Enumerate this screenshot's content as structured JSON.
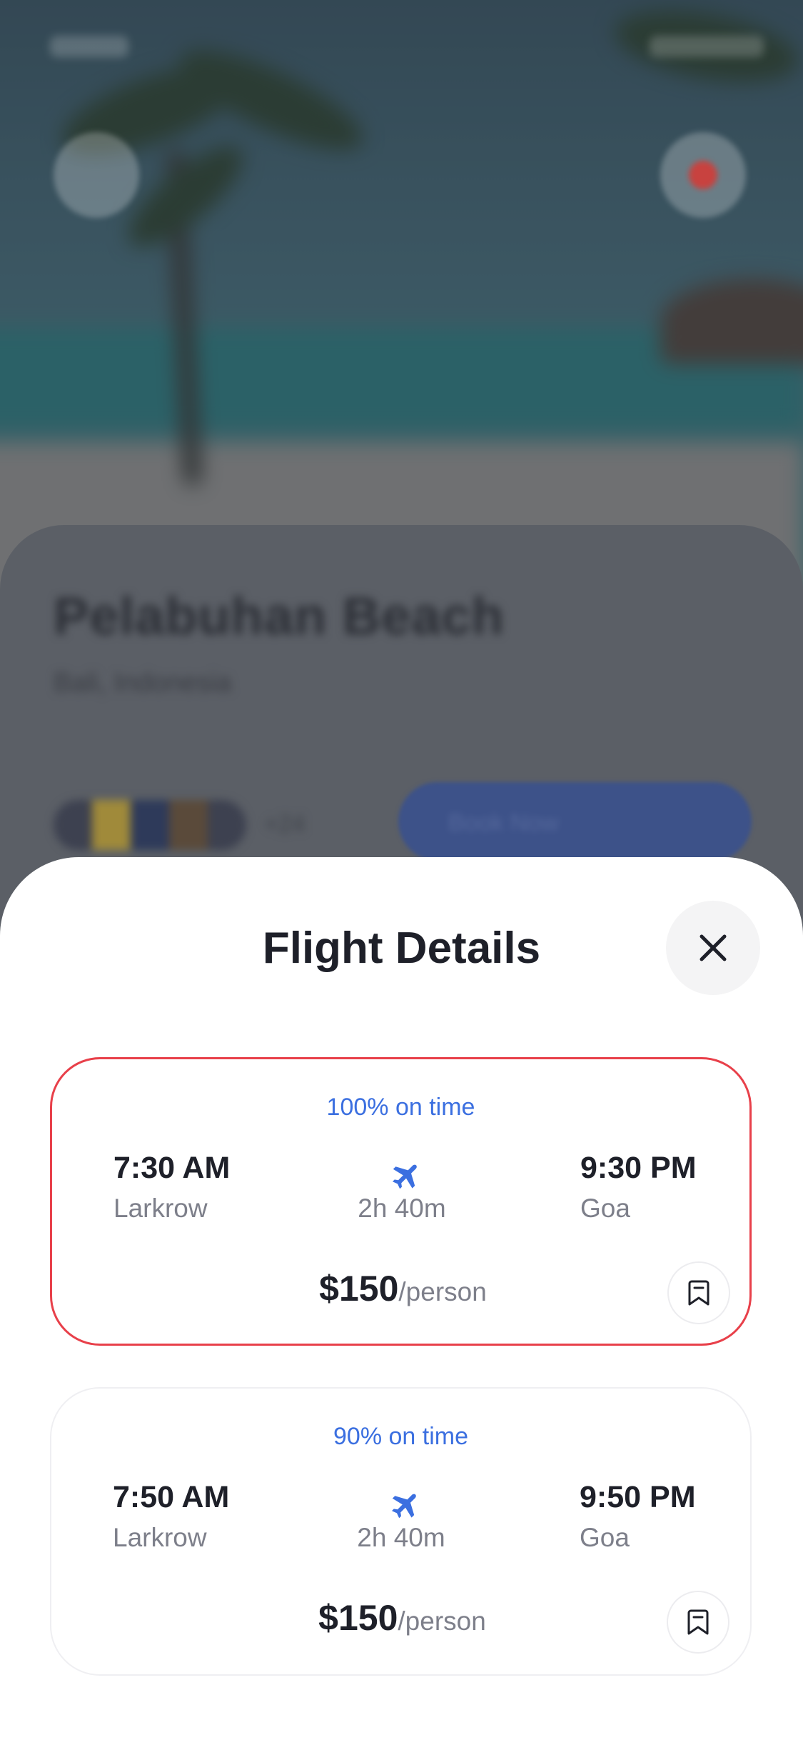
{
  "background": {
    "place_name": "Pelabuhan Beach",
    "place_location": "Bali, Indonesia",
    "visitors_count": "+24",
    "action_button_label": "Book Now"
  },
  "sheet": {
    "title": "Flight Details",
    "close_icon": "close-icon"
  },
  "flights": [
    {
      "on_time": "100% on time",
      "departure_time": "7:30 AM",
      "departure_city": "Larkrow",
      "duration": "2h 40m",
      "arrival_time": "9:30 PM",
      "arrival_city": "Goa",
      "price": "$150",
      "price_unit": "/person",
      "selected": true
    },
    {
      "on_time": "90% on time",
      "departure_time": "7:50 AM",
      "departure_city": "Larkrow",
      "duration": "2h 40m",
      "arrival_time": "9:50 PM",
      "arrival_city": "Goa",
      "price": "$150",
      "price_unit": "/person",
      "selected": false
    }
  ],
  "colors": {
    "accent_blue": "#3b6fe0",
    "selected_border": "#e8404a",
    "text_dark": "#1e2029",
    "text_muted": "#7d7f8a"
  },
  "icons": [
    "close-icon",
    "airplane-icon",
    "bookmark-icon"
  ]
}
